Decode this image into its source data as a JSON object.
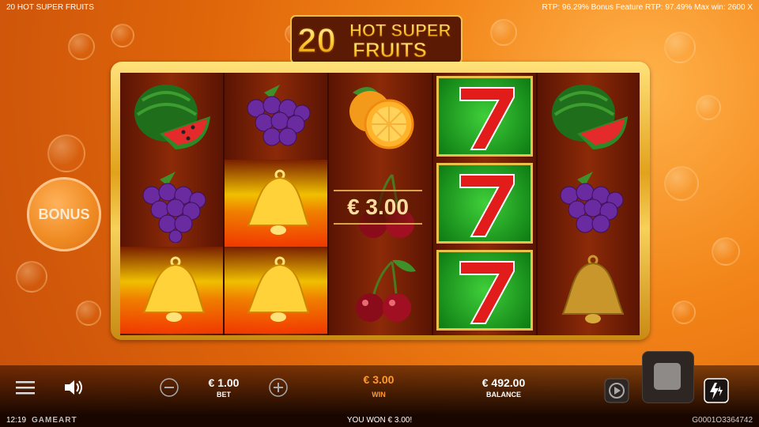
{
  "game_title": "20 HOT SUPER FRUITS",
  "info_line": "RTP: 96.29% Bonus Feature RTP: 97.49% Max win: 2600 X",
  "logo": {
    "number": "20",
    "line1": "HOT SUPER",
    "line2": "FRUITS"
  },
  "reels": [
    [
      "watermelon",
      "grapes",
      "bell-fire"
    ],
    [
      "grapes",
      "bell-fire",
      "bell-fire"
    ],
    [
      "orange",
      "cherries",
      "cherries"
    ],
    [
      "seven",
      "seven",
      "seven"
    ],
    [
      "watermelon",
      "grapes",
      "bell"
    ]
  ],
  "win_overlay": "€ 3.00",
  "bonus_button": "BONUS",
  "bet": {
    "value": "€ 1.00",
    "label": "BET"
  },
  "win": {
    "value": "€ 3.00",
    "label": "WIN"
  },
  "balance": {
    "value": "€ 492.00",
    "label": "BALANCE"
  },
  "clock": "12:19",
  "provider": "GAMEART",
  "win_message": "YOU WON € 3.00!",
  "session_id": "G0001O3364742",
  "colors": {
    "win_value": "#ff9a33",
    "reel_seven": "#e21b1b"
  }
}
